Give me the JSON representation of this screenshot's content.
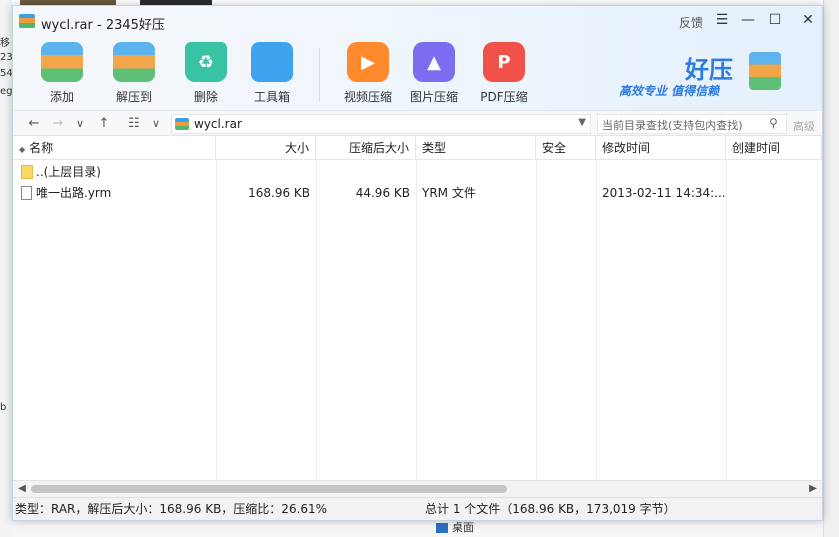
{
  "window": {
    "title": "wycl.rar - 2345好压",
    "feedback_label": "反馈",
    "controls": {
      "menu": "☰",
      "minimize": "—",
      "maximize": "☐",
      "close": "✕"
    }
  },
  "toolbar": {
    "items": [
      {
        "label": "添加",
        "icon": "add-archive-icon"
      },
      {
        "label": "解压到",
        "icon": "extract-icon"
      },
      {
        "label": "删除",
        "icon": "recycle-icon"
      },
      {
        "label": "工具箱",
        "icon": "toolbox-icon"
      },
      {
        "label": "视频压缩",
        "icon": "video-compress-icon"
      },
      {
        "label": "图片压缩",
        "icon": "image-compress-icon"
      },
      {
        "label": "PDF压缩",
        "icon": "pdf-compress-icon"
      }
    ]
  },
  "brand": {
    "name": "好压",
    "slogan": "高效专业  值得信赖"
  },
  "nav": {
    "back": "←",
    "forward": "→",
    "history": "∨",
    "up": "↑",
    "view": "☷",
    "view_dd": "∨",
    "path": "wycl.rar",
    "path_dropdown": "▼",
    "search_placeholder": "当前目录查找(支持包内查找)",
    "advanced_label": "高级"
  },
  "columns": [
    "名称",
    "大小",
    "压缩后大小",
    "类型",
    "安全",
    "修改时间",
    "创建时间"
  ],
  "rows": [
    {
      "name": "..(上层目录)",
      "size": "",
      "packed": "",
      "type": "",
      "security": "",
      "modified": "",
      "created": "",
      "kind": "folder"
    },
    {
      "name": "唯一出路.yrm",
      "size": "168.96 KB",
      "packed": "44.96 KB",
      "type": "YRM 文件",
      "security": "",
      "modified": "2013-02-11 14:34:...",
      "created": "",
      "kind": "file"
    }
  ],
  "status": {
    "left": "类型：RAR，解压后大小：168.96 KB，压缩比：26.61%",
    "right": "总计 1 个文件（168.96 KB，173,019 字节）"
  },
  "background": {
    "bottom_item": "桌面",
    "left_fragments": [
      "移",
      "23",
      "54",
      "eg",
      "b"
    ]
  },
  "colors": {
    "accent": "#2d7be0",
    "header_bg": "#eef5fc",
    "status_bg": "#f0f2f5"
  }
}
